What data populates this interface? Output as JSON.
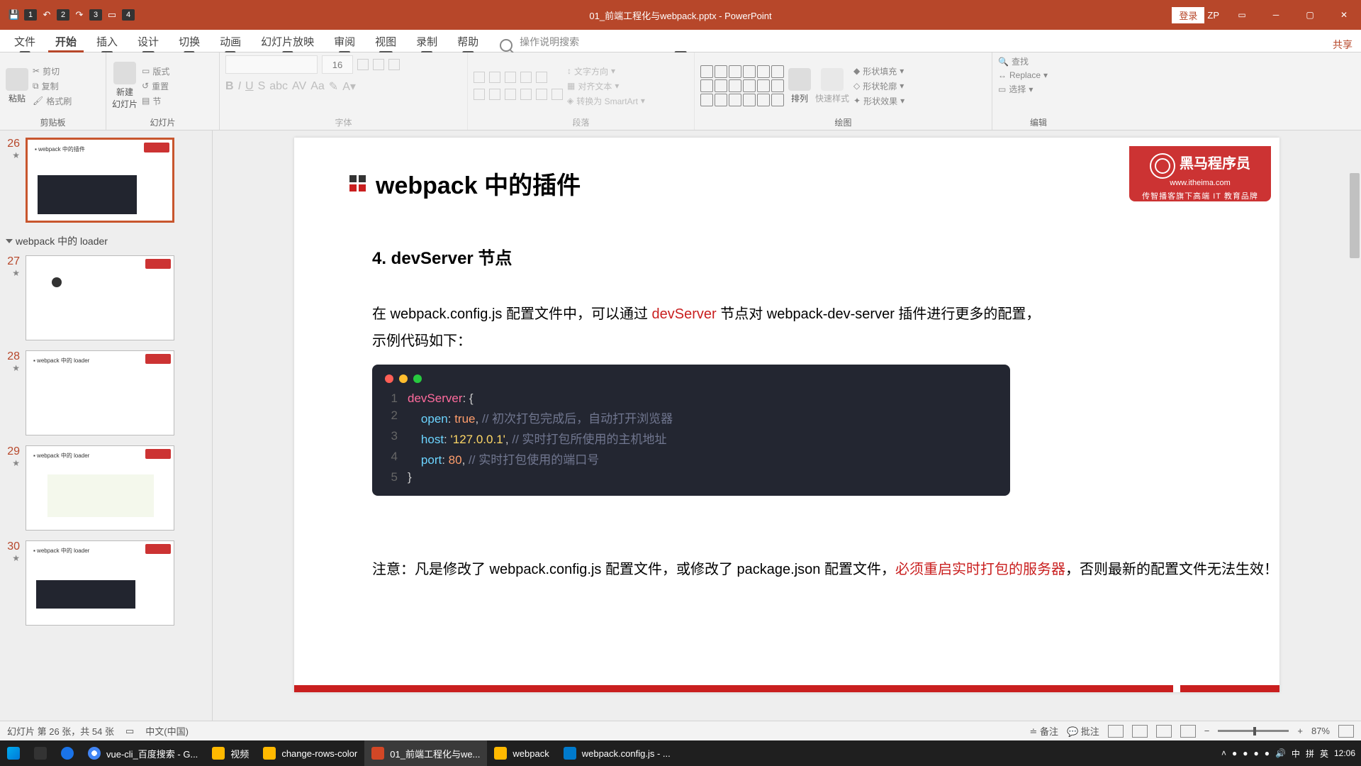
{
  "titlebar": {
    "qat_keys": [
      "1",
      "2",
      "3",
      "4"
    ],
    "filename": "01_前端工程化与webpack.pptx - PowerPoint",
    "login": "登录",
    "zp": "ZP"
  },
  "tabs": {
    "file": "文件",
    "home": "开始",
    "insert": "插入",
    "design": "设计",
    "transition": "切换",
    "animation": "动画",
    "slideshow": "幻灯片放映",
    "review": "审阅",
    "view": "视图",
    "record": "录制",
    "help": "帮助",
    "tellme": "操作说明搜索",
    "share": "共享"
  },
  "tabkeys": {
    "file": "F",
    "home": "H",
    "insert": "N",
    "design": "G",
    "transition": "K",
    "animation": "A",
    "slideshow": "S",
    "review": "R",
    "view": "W",
    "record": "C",
    "help": "Y",
    "tellme": "Q",
    "share": "ZS"
  },
  "ribbon": {
    "clipboard": {
      "paste": "粘贴",
      "cut": "剪切",
      "copy": "复制",
      "formatpainter": "格式刷",
      "group": "剪贴板"
    },
    "slides": {
      "new": "新建\n幻灯片",
      "layout": "版式",
      "reset": "重置",
      "sections": "节",
      "group": "幻灯片"
    },
    "font": {
      "size": "16",
      "group": "字体"
    },
    "paragraph": {
      "textdir": "文字方向",
      "align": "对齐文本",
      "smartart": "转换为 SmartArt",
      "group": "段落"
    },
    "drawing": {
      "arrange": "排列",
      "quickstyle": "快速样式",
      "fill": "形状填充",
      "outline": "形状轮廓",
      "effects": "形状效果",
      "group": "绘图"
    },
    "editing": {
      "find": "查找",
      "replace": "Replace",
      "select": "选择",
      "group": "编辑"
    }
  },
  "panel": {
    "section": "webpack 中的 loader",
    "slides": [
      26,
      27,
      28,
      29,
      30
    ]
  },
  "slide": {
    "title": "webpack 中的插件",
    "sub": "4. devServer 节点",
    "brand1": "黑马程序员",
    "brand2": "www.itheima.com",
    "brand3": "传智播客旗下高端 IT 教育品牌",
    "body_a": "在 webpack.config.js 配置文件中，可以通过 ",
    "body_b": "devServer",
    "body_c": " 节点对 webpack-dev-server 插件进行更多的配置，",
    "body_d": "示例代码如下：",
    "note_a": "注意：凡是修改了 webpack.config.js 配置文件，或修改了 package.json 配置文件，",
    "note_b": "必须重启实时打包的服务器",
    "note_c": "，否则最新的配置文件无法生效！",
    "code": {
      "l1a": "devServer",
      "l1b": ": {",
      "l2a": "open",
      "l2b": ": ",
      "l2c": "true",
      "l2d": ",",
      "l2e": " // 初次打包完成后，自动打开浏览器",
      "l3a": "host",
      "l3b": ": ",
      "l3c": "'127.0.0.1'",
      "l3d": ",",
      "l3e": " // 实时打包所使用的主机地址",
      "l4a": "port",
      "l4b": ": ",
      "l4c": "80",
      "l4d": ",",
      "l4e": " // 实时打包使用的端口号",
      "l5a": "}"
    }
  },
  "status": {
    "slideinfo": "幻灯片 第 26 张，共 54 张",
    "lang": "中文(中国)",
    "notes": "备注",
    "comments": "批注",
    "zoom": "87%"
  },
  "taskbar": {
    "vuecli": "vue-cli_百度搜索 - G...",
    "video": "视频",
    "changerows": "change-rows-color",
    "ppt": "01_前端工程化与we...",
    "webpack": "webpack",
    "vscode": "webpack.config.js - ...",
    "kb_zh": "中",
    "kb_pin": "拼",
    "kb_en": "英",
    "time": "12:06"
  }
}
